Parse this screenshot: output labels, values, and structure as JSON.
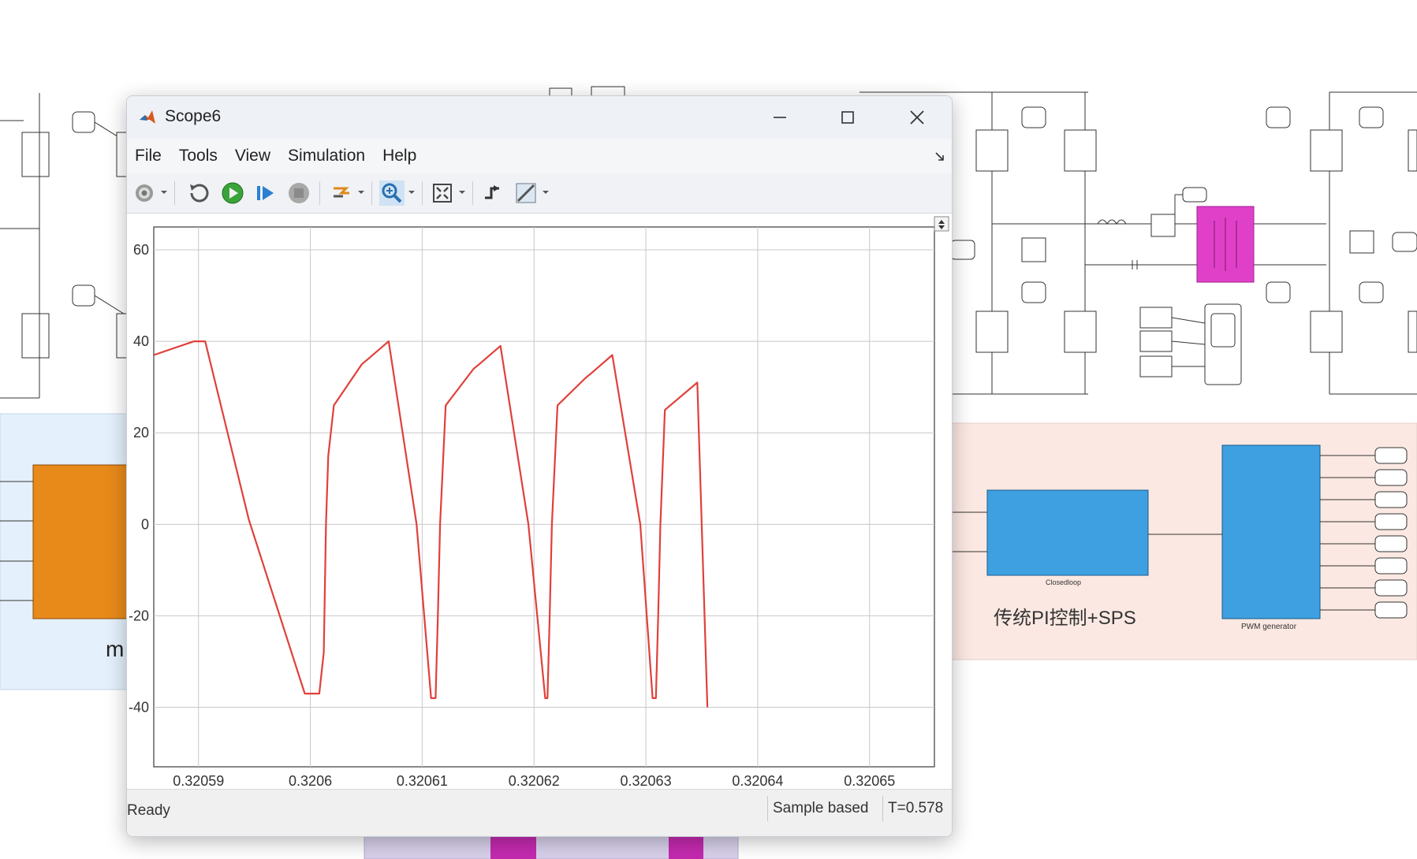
{
  "window": {
    "title": "Scope6",
    "status": "Ready",
    "status_mode": "Sample based",
    "status_time": "T=0.578"
  },
  "menu": [
    "File",
    "Tools",
    "View",
    "Simulation",
    "Help"
  ],
  "toolbar": {
    "icons": [
      "settings-icon",
      "restore-icon",
      "run-icon",
      "step-forward-icon",
      "stop-icon",
      "highlight-simulink-icon",
      "zoom-in-icon",
      "fit-to-view-icon",
      "triggers-icon",
      "cursor-measurements-icon"
    ]
  },
  "model": {
    "pi_label": "传统PI控制+SPS",
    "closedloop_label": "Closedloop",
    "pwm_label": "PWM generator",
    "partial_label": "m"
  },
  "colors": {
    "trace": "#e0403a",
    "transformer": "#e040c8",
    "orange_block": "#e88a1a",
    "blue_block": "#3ea0e0",
    "pink_area": "#fbe8e2",
    "blue_area": "#e4f0fb",
    "purple_area": "#d8d0ea"
  },
  "chart_data": {
    "type": "line",
    "title": "",
    "xlabel": "",
    "ylabel": "",
    "xlim": [
      0.320586,
      0.3206558
    ],
    "ylim": [
      -53,
      65
    ],
    "x_ticks": [
      0.32059,
      0.3206,
      0.32061,
      0.32062,
      0.32063,
      0.32064,
      0.32065
    ],
    "x_tick_labels": [
      "0.32059",
      "0.3206",
      "0.32061",
      "0.32062",
      "0.32063",
      "0.32064",
      "0.32065"
    ],
    "y_ticks": [
      60,
      40,
      20,
      0,
      -20,
      -40
    ],
    "y_tick_labels": [
      "60",
      "40",
      "20",
      "0",
      "-20",
      "-40"
    ],
    "grid": true,
    "series": [
      {
        "x": [
          0.320586,
          0.3205896,
          0.3205906,
          0.3205945,
          0.3205995,
          0.3206008,
          0.3206012,
          0.3206014,
          0.3206016,
          0.3206021,
          0.3206046,
          0.3206051,
          0.320607,
          0.3206095,
          0.3206108,
          0.3206112,
          0.3206114,
          0.3206116,
          0.3206121,
          0.3206146,
          0.3206151,
          0.320617,
          0.3206195,
          0.320621,
          0.3206212,
          0.3206214,
          0.3206216,
          0.3206221,
          0.3206246,
          0.3206251,
          0.320627,
          0.3206295,
          0.3206306,
          0.3206309,
          0.3206311,
          0.3206313,
          0.3206317,
          0.3206346,
          0.3206355
        ],
        "y": [
          37,
          40,
          40,
          1,
          -37,
          -37,
          -28,
          0,
          15,
          26,
          35,
          36,
          40,
          0,
          -38,
          -38,
          -20,
          0,
          26,
          34,
          35,
          39,
          0,
          -38,
          -38,
          -20,
          0,
          26,
          32,
          33,
          37,
          0,
          -38,
          -38,
          -20,
          0,
          25,
          31,
          -40
        ]
      }
    ]
  }
}
